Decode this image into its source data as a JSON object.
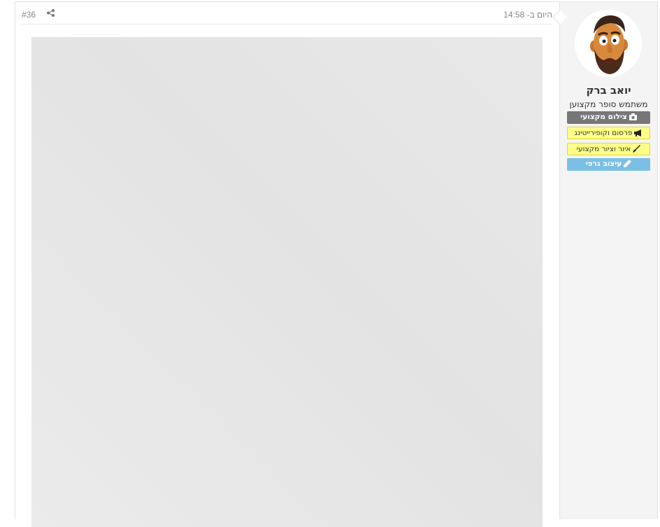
{
  "post": {
    "number": "#36",
    "time": "היום ב- 14:58"
  },
  "user": {
    "name": "יואב ברק",
    "rank": "משתמש סופר מקצוען",
    "badges": [
      {
        "label": "צילום מקצועי",
        "icon": "camera-icon",
        "color": "#777777"
      },
      {
        "label": "פרסום וקופירייטינג",
        "icon": "megaphone-icon",
        "color": "#ffff88"
      },
      {
        "label": "איור וציור מקצועי",
        "icon": "brush-icon",
        "color": "#ffff88"
      },
      {
        "label": "עיצוב גרפי",
        "icon": "pencil-icon",
        "color": "#7bc0e4"
      }
    ]
  },
  "icons": {
    "share": "share-icon",
    "avatar": "cartoon-avatar"
  }
}
